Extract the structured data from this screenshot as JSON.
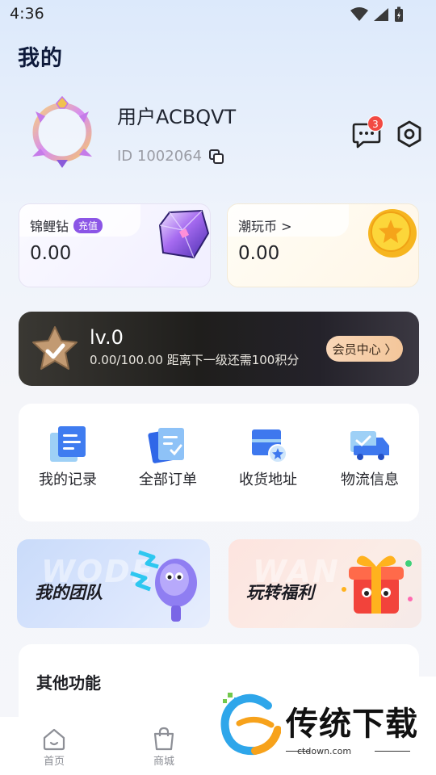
{
  "status_bar": {
    "time": "4:36"
  },
  "page": {
    "title": "我的"
  },
  "profile": {
    "username": "用户ACBQVT",
    "id_text": "ID 1002064",
    "message_count": "3"
  },
  "wallet": {
    "koi": {
      "label": "锦鲤钻",
      "tag": "充值",
      "value": "0.00"
    },
    "coin": {
      "label": "潮玩币 >",
      "value": "0.00"
    }
  },
  "vip": {
    "level": "lv.0",
    "progress_text": "0.00/100.00 距离下一级还需100积分",
    "center_button": "会员中心 〉"
  },
  "quick_menu": [
    {
      "label": "我的记录",
      "icon": "record-icon"
    },
    {
      "label": "全部订单",
      "icon": "orders-icon"
    },
    {
      "label": "收货地址",
      "icon": "address-icon"
    },
    {
      "label": "物流信息",
      "icon": "logistics-icon"
    }
  ],
  "promos": {
    "team": {
      "title": "我的团队",
      "ghost": "WODE"
    },
    "welfare": {
      "title": "玩转福利",
      "ghost": "WAN"
    }
  },
  "other": {
    "title": "其他功能"
  },
  "bottom_nav": [
    {
      "label": "首页",
      "icon": "home-icon"
    },
    {
      "label": "商城",
      "icon": "shopping-bag-icon"
    }
  ],
  "watermark": {
    "brand": "传统下载",
    "url": "ctdown.com"
  },
  "colors": {
    "accent_purple": "#8b55e6",
    "badge_red": "#f24a43",
    "vip_button": "#f3c69a"
  }
}
